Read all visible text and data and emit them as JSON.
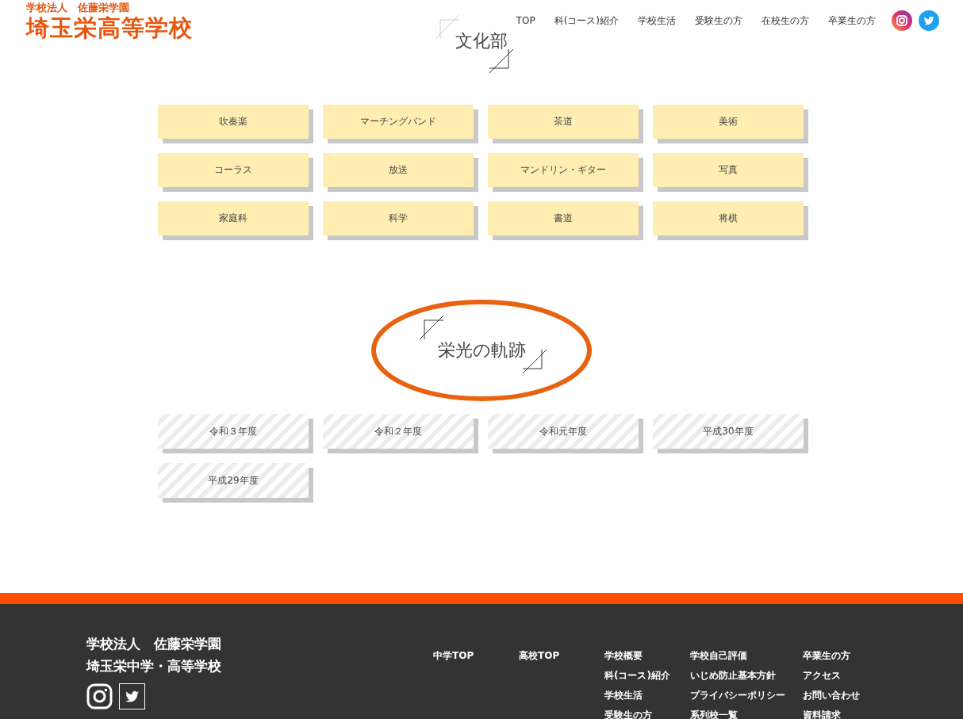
{
  "header": {
    "org": "学校法人　佐藤栄学園",
    "school": "埼玉栄高等学校",
    "nav": [
      "TOP",
      "科(コース)紹介",
      "学校生活",
      "受験生の方",
      "在校生の方",
      "卒業生の方"
    ]
  },
  "sections": [
    {
      "title": "文化部",
      "kind": "plain",
      "items": [
        "吹奏楽",
        "マーチングバンド",
        "茶道",
        "美術",
        "コーラス",
        "放送",
        "マンドリン・ギター",
        "写真",
        "家庭科",
        "科学",
        "書道",
        "将棋"
      ]
    },
    {
      "title": "栄光の軌跡",
      "kind": "striped",
      "items": [
        "令和３年度",
        "令和２年度",
        "令和元年度",
        "平成30年度",
        "平成29年度"
      ]
    }
  ],
  "footer": {
    "org_lines": [
      "学校法人　佐藤栄学園",
      "埼玉栄中学・高等学校"
    ],
    "link_columns": [
      [
        "中学TOP"
      ],
      [
        "高校TOP"
      ],
      [
        "学校概要",
        "科(コース)紹介",
        "学校生活",
        "受験生の方"
      ],
      [
        "学校自己評価",
        "いじめ防止基本方針",
        "プライバシーポリシー",
        "系列校一覧"
      ],
      [
        "卒業生の方",
        "アクセス",
        "お問い合わせ",
        "資料請求"
      ]
    ]
  }
}
